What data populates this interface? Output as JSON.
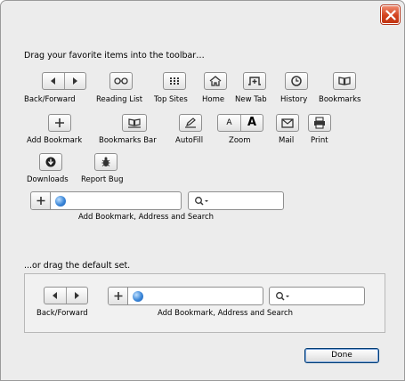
{
  "instructions": "Drag your favorite items into the toolbar…",
  "toolbar_items": {
    "back_forward": "Back/Forward",
    "reading_list": "Reading List",
    "top_sites": "Top Sites",
    "home": "Home",
    "new_tab": "New Tab",
    "history": "History",
    "bookmarks": "Bookmarks",
    "add_bookmark": "Add Bookmark",
    "bookmarks_bar": "Bookmarks Bar",
    "autofill": "AutoFill",
    "zoom": "Zoom",
    "mail": "Mail",
    "print": "Print",
    "downloads": "Downloads",
    "report_bug": "Report Bug",
    "address_search": "Add Bookmark, Address and Search"
  },
  "zoom_glyph_small": "A",
  "zoom_glyph_large": "A",
  "default_set_label": "...or drag the default set.",
  "default_set": {
    "back_forward": "Back/Forward",
    "address_search": "Add Bookmark, Address and Search"
  },
  "done_label": "Done"
}
